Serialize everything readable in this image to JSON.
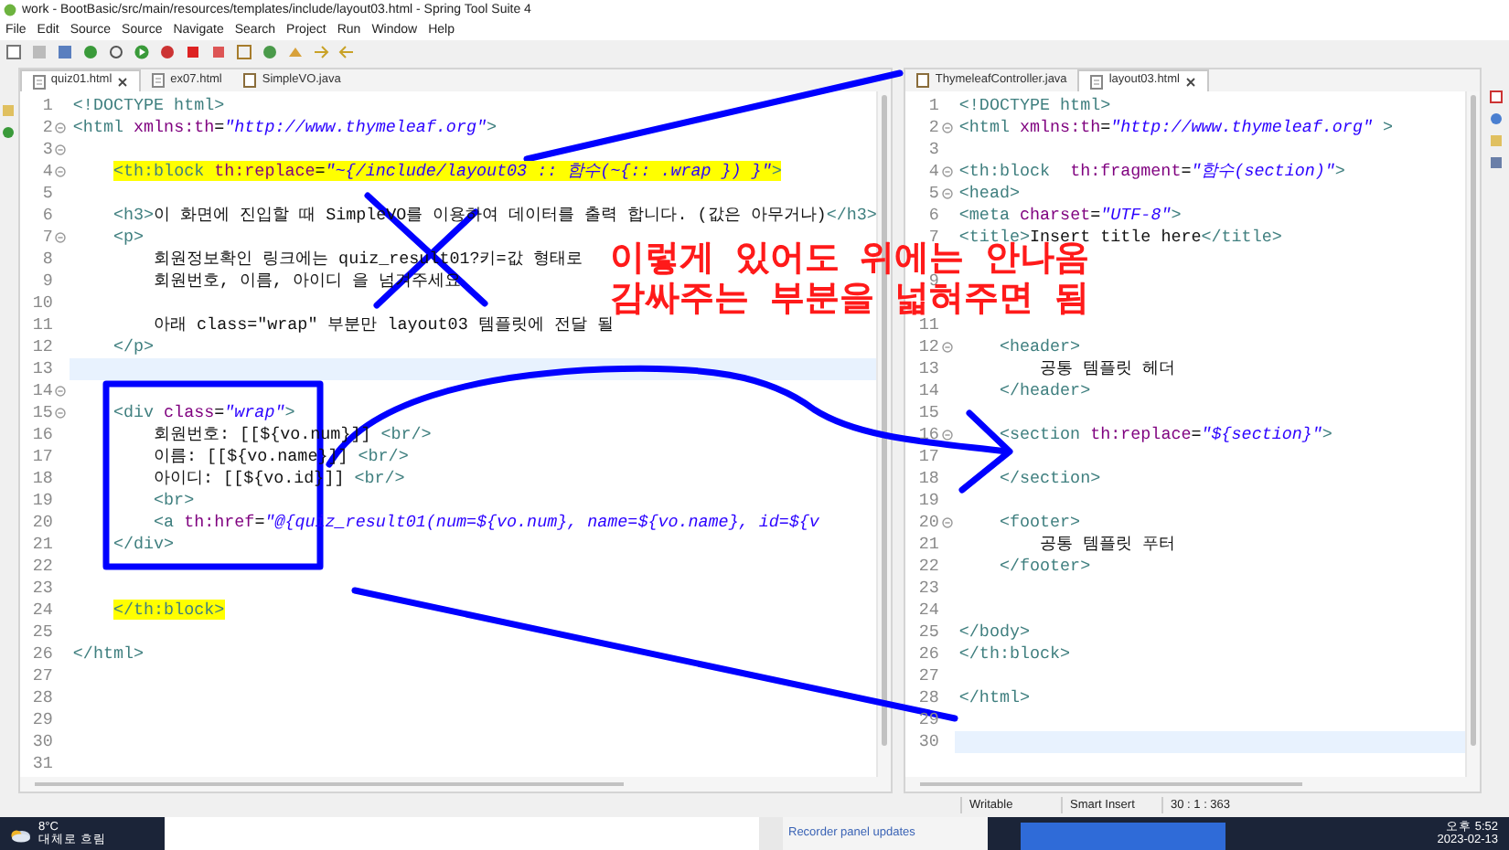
{
  "window": {
    "title": "work - BootBasic/src/main/resources/templates/include/layout03.html - Spring Tool Suite 4"
  },
  "menu": [
    "File",
    "Edit",
    "Source",
    "Source",
    "Navigate",
    "Search",
    "Project",
    "Run",
    "Window",
    "Help"
  ],
  "left_editor": {
    "tabs": [
      {
        "label": "quiz01.html",
        "selected": true,
        "kind": "html"
      },
      {
        "label": "ex07.html",
        "selected": false,
        "kind": "html"
      },
      {
        "label": "SimpleVO.java",
        "selected": false,
        "kind": "java"
      }
    ],
    "lines": [
      {
        "n": "1",
        "tokens": [
          {
            "kind": "tag",
            "text": "<!DOCTYPE html>"
          }
        ]
      },
      {
        "n": "2",
        "fold": true,
        "tokens": [
          {
            "kind": "tag",
            "text": "<html "
          },
          {
            "kind": "attr",
            "text": "xmlns:th"
          },
          {
            "kind": "txt",
            "text": "="
          },
          {
            "kind": "str",
            "text": "\"http://www.thymeleaf.org\""
          },
          {
            "kind": "tag",
            "text": ">"
          }
        ]
      },
      {
        "n": "3",
        "fold": true
      },
      {
        "n": "4",
        "fold": true,
        "marked": true,
        "tokens": [
          {
            "kind": "tag",
            "text": "    <th:block "
          },
          {
            "kind": "attr",
            "text": "th:replace"
          },
          {
            "kind": "txt",
            "text": "="
          },
          {
            "kind": "str",
            "text": "\"~{/include/layout03 :: 함수(~{:: .wrap }) }\""
          },
          {
            "kind": "tag",
            "text": ">"
          }
        ]
      },
      {
        "n": "5"
      },
      {
        "n": "6",
        "tokens": [
          {
            "kind": "tag",
            "text": "    <h3>"
          },
          {
            "kind": "txt",
            "text": "이 화면에 진입할 때 SimpleVO를 이용하여 데이터를 출력 합니다. (값은 아무거나)"
          },
          {
            "kind": "tag",
            "text": "</h3>"
          }
        ]
      },
      {
        "n": "7",
        "fold": true,
        "tokens": [
          {
            "kind": "tag",
            "text": "    <p>"
          }
        ]
      },
      {
        "n": "8",
        "tokens": [
          {
            "kind": "txt",
            "text": "        회원정보확인 링크에는 quiz_result01?키=값 형태로"
          }
        ]
      },
      {
        "n": "9",
        "tokens": [
          {
            "kind": "txt",
            "text": "        회원번호, 이름, 아이디 을 넘겨주세요"
          }
        ]
      },
      {
        "n": "10"
      },
      {
        "n": "11",
        "tokens": [
          {
            "kind": "txt",
            "text": "        아래 class=\"wrap\" 부분만 layout03 템플릿에 전달 될"
          }
        ]
      },
      {
        "n": "12",
        "tokens": [
          {
            "kind": "tag",
            "text": "    </p>"
          }
        ]
      },
      {
        "n": "13",
        "current": true
      },
      {
        "n": "14",
        "fold": true
      },
      {
        "n": "15",
        "fold": true,
        "tokens": [
          {
            "kind": "tag",
            "text": "    <div "
          },
          {
            "kind": "attr",
            "text": "class"
          },
          {
            "kind": "txt",
            "text": "="
          },
          {
            "kind": "str",
            "text": "\"wrap\""
          },
          {
            "kind": "tag",
            "text": ">"
          }
        ]
      },
      {
        "n": "16",
        "tokens": [
          {
            "kind": "txt",
            "text": "        회원번호: [[${vo.num}]] "
          },
          {
            "kind": "tag",
            "text": "<br/>"
          }
        ]
      },
      {
        "n": "17",
        "tokens": [
          {
            "kind": "txt",
            "text": "        이름: [[${vo.name}]] "
          },
          {
            "kind": "tag",
            "text": "<br/>"
          }
        ]
      },
      {
        "n": "18",
        "tokens": [
          {
            "kind": "txt",
            "text": "        아이디: [[${vo.id}]] "
          },
          {
            "kind": "tag",
            "text": "<br/>"
          }
        ]
      },
      {
        "n": "19",
        "tokens": [
          {
            "kind": "tag",
            "text": "        <br>"
          }
        ]
      },
      {
        "n": "20",
        "tokens": [
          {
            "kind": "tag",
            "text": "        <a "
          },
          {
            "kind": "attr",
            "text": "th:href"
          },
          {
            "kind": "txt",
            "text": "="
          },
          {
            "kind": "str",
            "text": "\"@{quiz_result01(num=${vo.num}, name=${vo.name}, id=${v"
          }
        ]
      },
      {
        "n": "21",
        "tokens": [
          {
            "kind": "tag",
            "text": "    </div>"
          }
        ]
      },
      {
        "n": "22"
      },
      {
        "n": "23"
      },
      {
        "n": "24",
        "marked": true,
        "tokens": [
          {
            "kind": "tag",
            "text": "    </th:block>"
          }
        ]
      },
      {
        "n": "25"
      },
      {
        "n": "26",
        "tokens": [
          {
            "kind": "tag",
            "text": "</html>"
          }
        ]
      },
      {
        "n": "27"
      },
      {
        "n": "28"
      },
      {
        "n": "29"
      },
      {
        "n": "30"
      },
      {
        "n": "31"
      }
    ]
  },
  "right_editor": {
    "tabs": [
      {
        "label": "ThymeleafController.java",
        "selected": false,
        "kind": "java"
      },
      {
        "label": "layout03.html",
        "selected": true,
        "kind": "html"
      }
    ],
    "lines": [
      {
        "n": "1",
        "tokens": [
          {
            "kind": "tag",
            "text": "<!DOCTYPE html>"
          }
        ]
      },
      {
        "n": "2",
        "fold": true,
        "tokens": [
          {
            "kind": "tag",
            "text": "<html "
          },
          {
            "kind": "attr",
            "text": "xmlns:th"
          },
          {
            "kind": "txt",
            "text": "="
          },
          {
            "kind": "str",
            "text": "\"http://www.thymeleaf.org\""
          },
          {
            "kind": "tag",
            "text": " >"
          }
        ]
      },
      {
        "n": "3"
      },
      {
        "n": "4",
        "fold": true,
        "tokens": [
          {
            "kind": "tag",
            "text": "<th:block  "
          },
          {
            "kind": "attr",
            "text": "th:fragment"
          },
          {
            "kind": "txt",
            "text": "="
          },
          {
            "kind": "str",
            "text": "\"함수(section)\""
          },
          {
            "kind": "tag",
            "text": ">"
          }
        ]
      },
      {
        "n": "5",
        "fold": true,
        "tokens": [
          {
            "kind": "tag",
            "text": "<head>"
          }
        ]
      },
      {
        "n": "6",
        "tokens": [
          {
            "kind": "tag",
            "text": "<meta "
          },
          {
            "kind": "attr",
            "text": "charset"
          },
          {
            "kind": "txt",
            "text": "="
          },
          {
            "kind": "str",
            "text": "\"UTF-8\""
          },
          {
            "kind": "tag",
            "text": ">"
          }
        ]
      },
      {
        "n": "7",
        "tokens": [
          {
            "kind": "tag",
            "text": "<title>"
          },
          {
            "kind": "txt",
            "text": "Insert title here"
          },
          {
            "kind": "tag",
            "text": "</title>"
          }
        ]
      },
      {
        "kind": "covered"
      },
      {
        "n": "9"
      },
      {
        "kind": "covered"
      },
      {
        "n": "11"
      },
      {
        "n": "12",
        "fold": true,
        "tokens": [
          {
            "kind": "tag",
            "text": "    <header>"
          }
        ]
      },
      {
        "n": "13",
        "tokens": [
          {
            "kind": "txt",
            "text": "        공통 템플릿 헤더"
          }
        ]
      },
      {
        "n": "14",
        "tokens": [
          {
            "kind": "tag",
            "text": "    </header>"
          }
        ]
      },
      {
        "n": "15"
      },
      {
        "n": "16",
        "fold": true,
        "tokens": [
          {
            "kind": "tag",
            "text": "    <section "
          },
          {
            "kind": "attr",
            "text": "th:replace"
          },
          {
            "kind": "txt",
            "text": "="
          },
          {
            "kind": "str",
            "text": "\"${section}\""
          },
          {
            "kind": "tag",
            "text": ">"
          }
        ]
      },
      {
        "n": "17"
      },
      {
        "n": "18",
        "tokens": [
          {
            "kind": "tag",
            "text": "    </section>"
          }
        ]
      },
      {
        "n": "19"
      },
      {
        "n": "20",
        "fold": true,
        "tokens": [
          {
            "kind": "tag",
            "text": "    <footer>"
          }
        ]
      },
      {
        "n": "21",
        "tokens": [
          {
            "kind": "txt",
            "text": "        공통 템플릿 푸터"
          }
        ]
      },
      {
        "n": "22",
        "tokens": [
          {
            "kind": "tag",
            "text": "    </footer>"
          }
        ]
      },
      {
        "n": "23"
      },
      {
        "n": "24"
      },
      {
        "n": "25",
        "tokens": [
          {
            "kind": "tag",
            "text": "</body>"
          }
        ]
      },
      {
        "n": "26",
        "tokens": [
          {
            "kind": "tag",
            "text": "</th:block>"
          }
        ]
      },
      {
        "n": "27"
      },
      {
        "n": "28",
        "tokens": [
          {
            "kind": "tag",
            "text": "</html>"
          }
        ]
      },
      {
        "n": "29"
      },
      {
        "n": "30",
        "current": true
      }
    ]
  },
  "annotation": {
    "lines": [
      "이렇게 있어도 위에는 안나옴",
      "감싸주는 부분을 넓혀주면 됨"
    ]
  },
  "status_bar": [
    "Writable",
    "Smart Insert",
    "30 : 1 : 363"
  ],
  "taskbar": {
    "temperature": "8°C",
    "weather": "대체로 흐림",
    "notification": "Recorder panel updates",
    "time": "오후 5:52",
    "date": "2023-02-13"
  }
}
